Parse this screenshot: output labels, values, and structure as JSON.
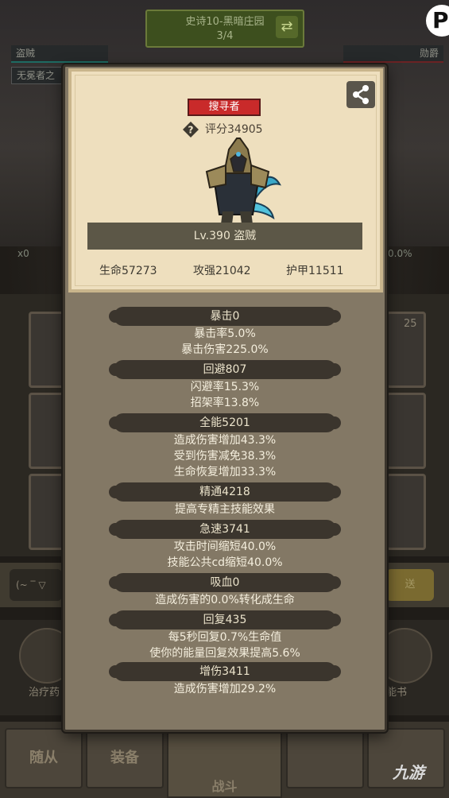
{
  "background": {
    "stage_title": "史诗10-黑暗庄园",
    "stage_progress": "3/4",
    "left_player_name": "盗贼",
    "left_player_sub": "无冕者之",
    "right_player_name": "勋爵",
    "left_hp_label": "x0",
    "right_hp_label": "0.0%",
    "slot_count": "25",
    "input_text": "(~ ‾ ▽",
    "send_label": "送",
    "action_left": "治疗药",
    "action_right": "能书",
    "nav": [
      "随从",
      "装备",
      "战斗",
      "",
      ""
    ],
    "watermark": "九游"
  },
  "modal": {
    "class_badge": "搜寻者",
    "score": "评分34905",
    "name": "Lv.390 盗贼",
    "hp": "生命57273",
    "attack": "攻强21042",
    "armor": "护甲11511",
    "attributes": [
      {
        "header": "暴击0",
        "lines": [
          "暴击率5.0%",
          "暴击伤害225.0%"
        ]
      },
      {
        "header": "回避807",
        "lines": [
          "闪避率15.3%",
          "招架率13.8%"
        ]
      },
      {
        "header": "全能5201",
        "lines": [
          "造成伤害增加43.3%",
          "受到伤害减免38.3%",
          "生命恢复增加33.3%"
        ]
      },
      {
        "header": "精通4218",
        "lines": [
          "提高专精主技能效果"
        ]
      },
      {
        "header": "急速3741",
        "lines": [
          "攻击时间缩短40.0%",
          "技能公共cd缩短40.0%"
        ]
      },
      {
        "header": "吸血0",
        "lines": [
          "造成伤害的0.0%转化成生命"
        ]
      },
      {
        "header": "回复435",
        "lines": [
          "每5秒回复0.7%生命值",
          "使你的能量回复效果提高5.6%"
        ]
      },
      {
        "header": "增伤3411",
        "lines": [
          "造成伤害增加29.2%"
        ]
      }
    ]
  }
}
